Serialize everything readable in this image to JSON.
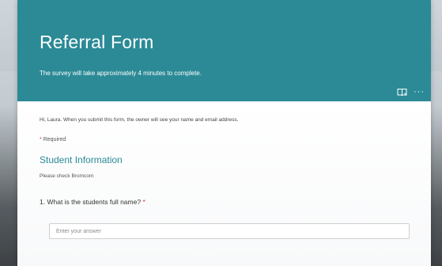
{
  "form": {
    "title": "Referral Form",
    "subtitle": "The survey will take approximately 4 minutes to complete.",
    "notice": "Hi, Laura. When you submit this form, the owner will see your name and email address.",
    "required_asterisk": "*",
    "required_label": "Required",
    "header_tools": {
      "immersive_reader_icon": "immersive-reader-icon",
      "more_label": "···"
    }
  },
  "section": {
    "title": "Student Information",
    "description": "Please check Bromcom"
  },
  "questions": [
    {
      "number": "1.",
      "text": "What is the students full name?",
      "required_marker": "*",
      "answer": {
        "value": "",
        "placeholder": "Enter your answer"
      }
    }
  ],
  "colors": {
    "theme": "#2b8a96",
    "required": "#c8412b"
  }
}
